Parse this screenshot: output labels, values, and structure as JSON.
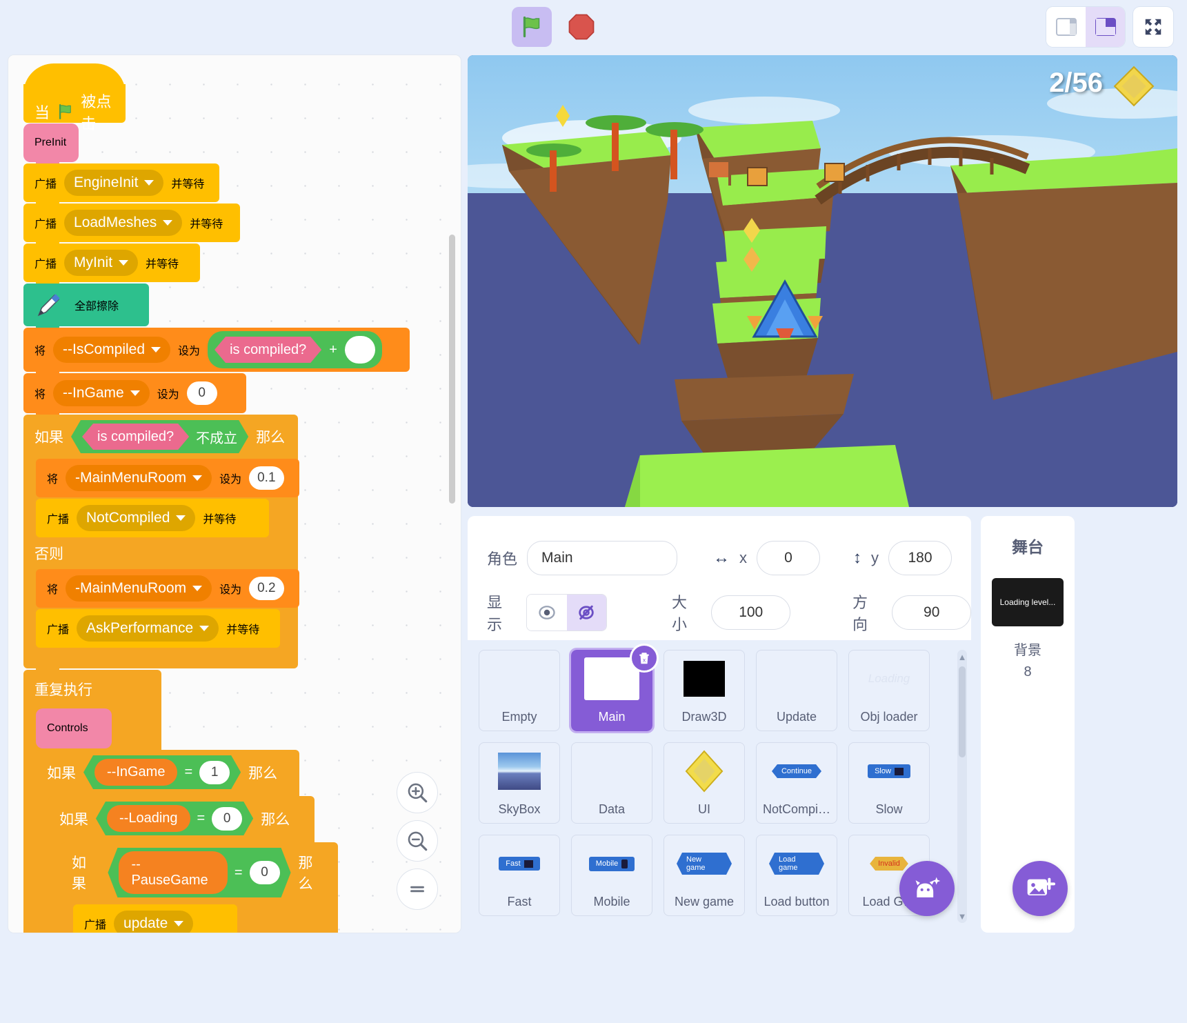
{
  "toolbar": {
    "green_flag_icon": "green-flag-icon",
    "stop_icon": "stop-sign-icon",
    "small_stage_icon": "small-stage-icon",
    "large_stage_icon": "large-stage-icon",
    "fullscreen_icon": "fullscreen-icon"
  },
  "code": {
    "hat_when": "当",
    "hat_clicked": "被点击",
    "preinit": "PreInit",
    "broadcast": "广播",
    "and_wait": "并等待",
    "msg_engineinit": "EngineInit",
    "msg_loadmeshes": "LoadMeshes",
    "msg_myinit": "MyInit",
    "msg_notcompiled": "NotCompiled",
    "msg_askperformance": "AskPerformance",
    "msg_update": "update",
    "pen_erase_all": "全部擦除",
    "set_to_prefix": "将",
    "set_to_suffix": "设为",
    "var_iscompiled": "--IsCompiled",
    "var_ingame": "--InGame",
    "var_mainmenuroom": "-MainMenuRoom",
    "var_loading": "--Loading",
    "var_pausegame": "--PauseGame",
    "op_is_compiled": "is compiled?",
    "op_plus": "+",
    "val_blank": "",
    "val_zero": "0",
    "val_one": "1",
    "val_01": "0.1",
    "val_02": "0.2",
    "if_word": "如果",
    "then_word": "那么",
    "else_word": "否则",
    "not_word": "不成立",
    "forever": "重复执行",
    "controls": "Controls",
    "equals": "=",
    "zoom_in_icon": "zoom-in-icon",
    "zoom_out_icon": "zoom-out-icon",
    "zoom_reset_icon": "zoom-reset-icon"
  },
  "stage": {
    "hud_counter": "2/56",
    "gem_icon": "gem-icon"
  },
  "sprite_info": {
    "name_label": "角色",
    "name_value": "Main",
    "x_label": "x",
    "x_value": "0",
    "y_label": "y",
    "y_value": "180",
    "show_label": "显示",
    "size_label": "大小",
    "size_value": "100",
    "direction_label": "方向",
    "direction_value": "90",
    "show_icon": "eye-icon",
    "hide_icon": "eye-slash-icon",
    "horizontal_arrow_icon": "horizontal-arrows-icon",
    "vertical_arrow_icon": "vertical-arrows-icon"
  },
  "sprites": [
    {
      "name": "Empty",
      "thumb": "blank"
    },
    {
      "name": "Main",
      "thumb": "white-square",
      "selected": true
    },
    {
      "name": "Draw3D",
      "thumb": "black-square"
    },
    {
      "name": "Update",
      "thumb": "blank"
    },
    {
      "name": "Obj loader",
      "thumb": "loading-text"
    },
    {
      "name": "SkyBox",
      "thumb": "skybox"
    },
    {
      "name": "Data",
      "thumb": "blank"
    },
    {
      "name": "UI",
      "thumb": "gem"
    },
    {
      "name": "NotCompi…",
      "thumb": "continue-button"
    },
    {
      "name": "Slow",
      "thumb": "slow-button"
    },
    {
      "name": "Fast",
      "thumb": "fast-button"
    },
    {
      "name": "Mobile",
      "thumb": "mobile-button"
    },
    {
      "name": "New game",
      "thumb": "newgame-button"
    },
    {
      "name": "Load button",
      "thumb": "loadgame-button"
    },
    {
      "name": "Load G…",
      "thumb": "invalid-button"
    }
  ],
  "sprite_badges": {
    "continue": "Continue",
    "slow": "Slow",
    "fast": "Fast",
    "mobile": "Mobile",
    "newgame": "New game",
    "loadgame": "Load game",
    "invalid": "Invalid",
    "loading": "Loading",
    "delete_icon": "delete-trash-icon",
    "add_sprite_icon": "add-sprite-cat-icon"
  },
  "stage_panel": {
    "title": "舞台",
    "thumb_text": "Loading level...",
    "backdrops_label": "背景",
    "backdrops_count": "8",
    "add_backdrop_icon": "add-backdrop-icon"
  },
  "colors": {
    "accent": "#855cd6",
    "events_yellow": "#ffbf00",
    "control_orange": "#f5a623",
    "variables_orange": "#ff8c1a",
    "operators_green": "#4cbf56",
    "custom_pink": "#f287a8",
    "pen_green": "#2dc08d",
    "stop_red": "#d94a42",
    "flag_green": "#5cb85c"
  }
}
